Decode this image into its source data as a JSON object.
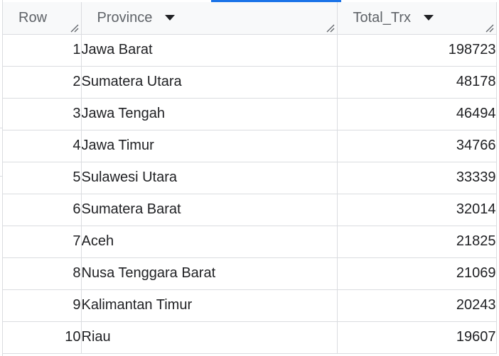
{
  "table": {
    "columns": [
      {
        "label": "Row",
        "sortable": false
      },
      {
        "label": "Province",
        "sortable": true
      },
      {
        "label": "Total_Trx",
        "sortable": true
      }
    ],
    "rows": [
      {
        "row": "1",
        "province": "Jawa Barat",
        "total": "198723"
      },
      {
        "row": "2",
        "province": "Sumatera Utara",
        "total": "48178"
      },
      {
        "row": "3",
        "province": "Jawa Tengah",
        "total": "46494"
      },
      {
        "row": "4",
        "province": "Jawa Timur",
        "total": "34766"
      },
      {
        "row": "5",
        "province": "Sulawesi Utara",
        "total": "33339"
      },
      {
        "row": "6",
        "province": "Sumatera Barat",
        "total": "32014"
      },
      {
        "row": "7",
        "province": "Aceh",
        "total": "21825"
      },
      {
        "row": "8",
        "province": "Nusa Tenggara Barat",
        "total": "21069"
      },
      {
        "row": "9",
        "province": "Kalimantan Timur",
        "total": "20243"
      },
      {
        "row": "10",
        "province": "Riau",
        "total": "19607"
      }
    ]
  },
  "icons": {
    "sort": "sort-dropdown-icon",
    "resize": "column-resize-icon"
  },
  "colors": {
    "accent": "#1a73e8",
    "grid_line": "#dadce0",
    "header_bg": "#f8f9fa",
    "header_text": "#5f6368",
    "cell_text": "#202124"
  }
}
